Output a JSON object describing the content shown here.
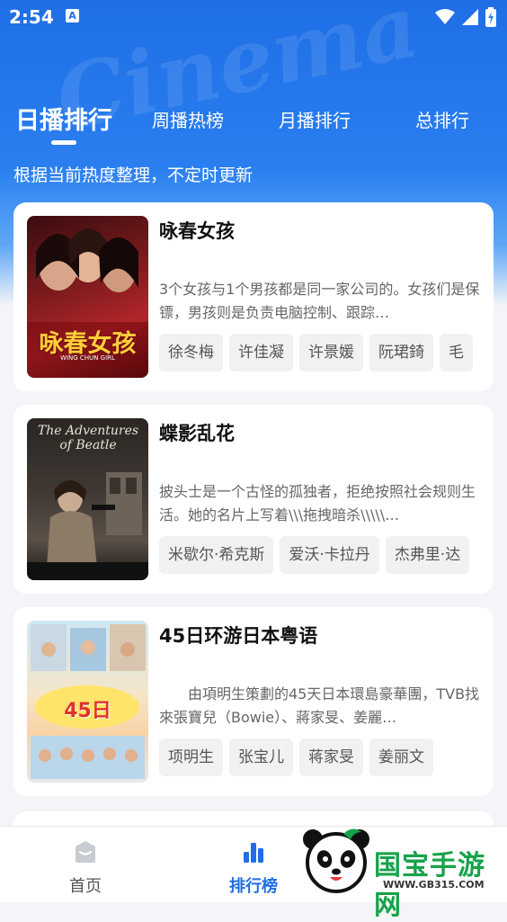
{
  "status_bar": {
    "time": "2:54",
    "notification_icon": "A"
  },
  "watermark_text": "Cinema",
  "tabs": [
    {
      "label": "日播排行",
      "active": true
    },
    {
      "label": "周播热榜",
      "active": false
    },
    {
      "label": "月播排行",
      "active": false
    },
    {
      "label": "总排行",
      "active": false
    }
  ],
  "subtitle": "根据当前热度整理，不定时更新",
  "cards": [
    {
      "title": "咏春女孩",
      "poster_text": "咏春女孩",
      "poster_subtext": "WING CHUN GIRL",
      "description": "3个女孩与1个男孩都是同一家公司的。女孩们是保镖，男孩则是负责电脑控制、跟踪…",
      "tags": [
        "徐冬梅",
        "许佳凝",
        "许景媛",
        "阮珺錡",
        "毛"
      ]
    },
    {
      "title": "蝶影乱花",
      "poster_text": "The Adventures of Beatle",
      "description": "披头士是一个古怪的孤独者，拒绝按照社会规则生活。她的名片上写着\\\\\\拖拽暗杀\\\\\\\\\\…",
      "tags": [
        "米歇尔·希克斯",
        "爱沃·卡拉丹",
        "杰弗里·达"
      ]
    },
    {
      "title": "45日环游日本粤语",
      "poster_text": "45日",
      "description": "　　由項明生策劃的45天日本環島豪華團，TVB找來張寶兒（Bowie）、蔣家旻、姜麗…",
      "tags": [
        "项明生",
        "张宝儿",
        "蒋家旻",
        "姜丽文"
      ]
    }
  ],
  "bottom_nav": [
    {
      "label": "首页",
      "icon": "home-icon",
      "active": false
    },
    {
      "label": "排行榜",
      "icon": "ranking-chart-icon",
      "active": true
    }
  ],
  "watermark_logo": {
    "text": "国宝手游网",
    "url": "WWW.GB315.COM"
  },
  "colors": {
    "primary": "#1f6ee6",
    "logo_green": "#17a34a"
  }
}
